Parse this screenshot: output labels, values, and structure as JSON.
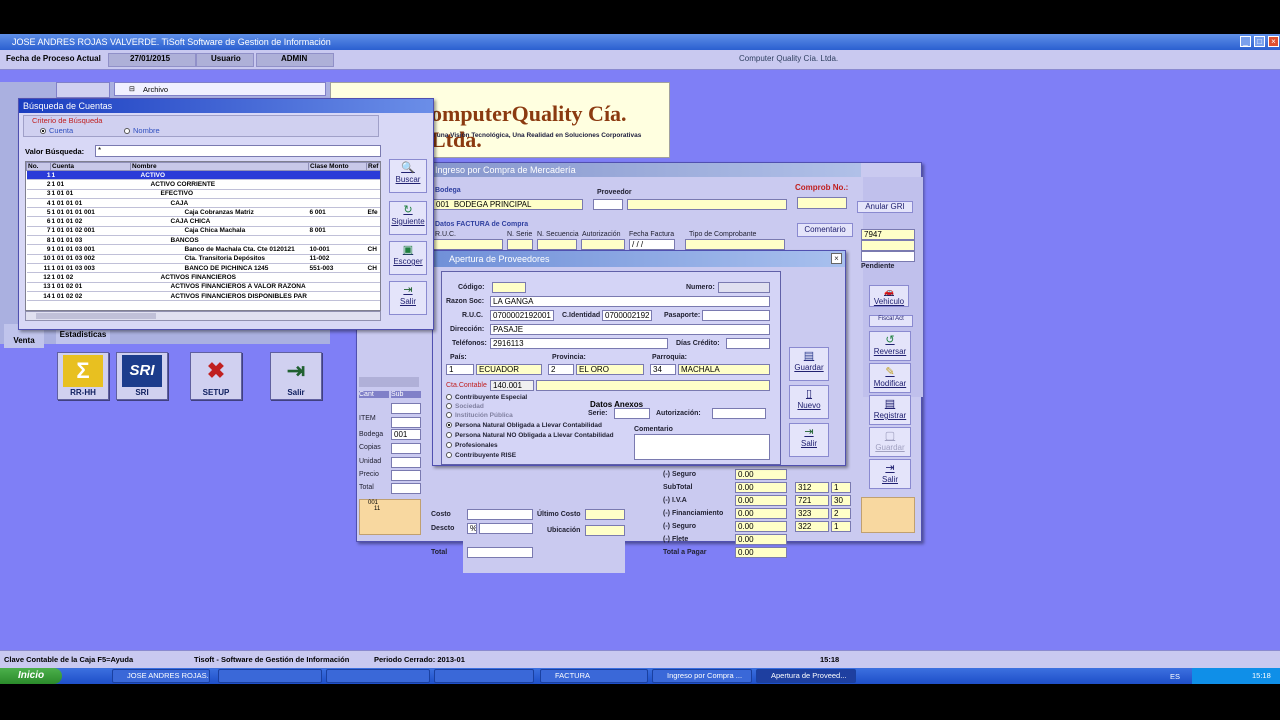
{
  "app": {
    "title": "JOSE ANDRES ROJAS VALVERDE. TiSoft Software de Gestion de Información",
    "company": "Computer Quality Cía. Ltda."
  },
  "infobar": {
    "fecha_label": "Fecha de Proceso Actual",
    "fecha_value": "27/01/2015",
    "usuario_label": "Usuario",
    "usuario_value": "ADMIN"
  },
  "menu": {
    "archivo": "Archivo"
  },
  "banner": {
    "name": "omputerQuality Cía. Ltda.",
    "slogan": "u una Visión Tecnológica, Una Realidad en Soluciones Corporativas"
  },
  "leftnav": {
    "ventas": "Venta",
    "estadisticas": "Estadisticas",
    "a": "A",
    "b": "B",
    "inv": "Inve"
  },
  "bigicons": [
    {
      "label": "RR-HH",
      "icon": "sigma-icon"
    },
    {
      "label": "SRI",
      "icon": "sri-logo"
    },
    {
      "label": "SETUP",
      "icon": "tools-icon"
    },
    {
      "label": "Salir",
      "icon": "exit-icon"
    }
  ],
  "busqueda": {
    "title": "Búsqueda de Cuentas",
    "criterio": "Criterio de Búsqueda",
    "opt_cuenta": "Cuenta",
    "opt_nombre": "Nombre",
    "valor_label": "Valor Búsqueda:",
    "valor_value": "*",
    "headers": [
      "No.",
      "Cuenta",
      "Nombre",
      "Clase Monto",
      "Ref"
    ],
    "rows": [
      [
        "1",
        "1",
        "ACTIVO",
        "",
        ""
      ],
      [
        "2",
        "1 01",
        "ACTIVO CORRIENTE",
        "",
        ""
      ],
      [
        "3",
        "1 01 01",
        "EFECTIVO",
        "",
        ""
      ],
      [
        "4",
        "1 01 01 01",
        "CAJA",
        "",
        ""
      ],
      [
        "5",
        "1 01 01 01   001",
        "Caja Cobranzas Matriz",
        "6 001",
        "Efe"
      ],
      [
        "6",
        "1 01 01 02",
        "CAJA CHICA",
        "",
        ""
      ],
      [
        "7",
        "1 01 01 02   001",
        "Caja Chica Machala",
        "8 001",
        "",
        ""
      ],
      [
        "8",
        "1 01 01 03",
        "BANCOS",
        "",
        ""
      ],
      [
        "9",
        "1 01 01 03   001",
        "Banco de Machala Cta. Cte 0120121",
        "10-001",
        "CH"
      ],
      [
        "10",
        "1 01 01 03   002",
        "Cta. Transitoria Depósitos",
        "11-002",
        ""
      ],
      [
        "11",
        "1 01 01 03   003",
        "BANCO DE PICHINCA 1245",
        "551-003",
        "CH"
      ],
      [
        "12",
        "1 01 02",
        "ACTIVOS FINANCIEROS",
        "",
        ""
      ],
      [
        "13",
        "1 01 02 01",
        "ACTIVOS FINANCIEROS A VALOR RAZONA",
        "",
        ""
      ],
      [
        "14",
        "1 01 02 02",
        "ACTIVOS FINANCIEROS DISPONIBLES PAR",
        "",
        ""
      ]
    ],
    "buttons": {
      "buscar": "Buscar",
      "siguiente": "Siguiente",
      "escoger": "Escoger",
      "salir": "Salir"
    }
  },
  "compra": {
    "title": "Ingreso por Compra de Mercadería",
    "bodega_label": "Bodega",
    "bodega_code": "001",
    "bodega_value": "BODEGA PRINCIPAL",
    "proveedor_label": "Proveedor",
    "comprob_label": "Comprob No.:",
    "factura_label": "Datos FACTURA de Compra",
    "ruc": "R.U.C.",
    "serie": "N. Serie",
    "secuencia": "N. Secuencia",
    "autorizacion": "Autorización",
    "fecha_fact": "Fecha Factura",
    "tipo_comp": "Tipo de Comprobante",
    "fecha_val": "/ / /",
    "comentario": "Comentario",
    "vehiculo": "Vehiculo",
    "emitir": "Anular GRI",
    "num": "7947",
    "fiscal": "Fiscal Act",
    "pendiente": "Pendiente",
    "reversar": "Reversar",
    "modificar": "Modificar",
    "registrar": "Registrar",
    "guardar": "Guardar",
    "salir": "Salir",
    "cant": "Cant",
    "sub": "Sub",
    "item": "ITEM",
    "bodega2": "Bodega",
    "bodega2_val": "001",
    "copias": "Copias",
    "unidad": "Unidad",
    "precio": "Precio",
    "total": "Total",
    "item_vals": [
      "001",
      "11"
    ],
    "costo": "Costo",
    "ultimo": "Último Costo",
    "descto": "Descto",
    "pct": "%",
    "ubicacion": "Ubicación",
    "total2": "Total",
    "totals": [
      {
        "label": "(-) Seguro",
        "v": "0.00",
        "c1": "",
        "c2": ""
      },
      {
        "label": "SubTotal",
        "v": "0.00",
        "c1": "312",
        "c2": "1"
      },
      {
        "label": "(-) I.V.A",
        "v": "0.00",
        "c1": "721",
        "c2": "30"
      },
      {
        "label": "(-) Financiamiento",
        "v": "0.00",
        "c1": "323",
        "c2": "2"
      },
      {
        "label": "(-) Seguro",
        "v": "0.00",
        "c1": "322",
        "c2": "1"
      },
      {
        "label": "(-) Flete",
        "v": "0.00",
        "c1": "",
        "": ""
      },
      {
        "label": "Total a Pagar",
        "v": "0.00",
        "c1": "",
        "c2": ""
      }
    ]
  },
  "proveedores": {
    "title": "Apertura de Proveedores",
    "codigo": "Código:",
    "numero": "Numero:",
    "razon": "Razon Soc:",
    "razon_val": "LA GANGA",
    "ruc": "R.U.C.",
    "ruc_val": "0700002192001",
    "cid": "C.Identidad",
    "cid_val": "0700002192",
    "pasaporte": "Pasaporte:",
    "direccion": "Dirección:",
    "direccion_val": "PASAJE",
    "telefonos": "Teléfonos:",
    "telefonos_val": "2916113",
    "dias": "Días Crédito:",
    "pais": "País:",
    "pais_code": "1",
    "pais_val": "ECUADOR",
    "provincia": "Provincia:",
    "provincia_code": "2",
    "provincia_val": "EL ORO",
    "parroquia": "Parroquia:",
    "parroquia_code": "34",
    "parroquia_val": "MACHALA",
    "cta": "Cta.Contable",
    "cta_val": "140.001",
    "anexos": "Datos Anexos",
    "serie": "Serie:",
    "autorizacion": "Autorización:",
    "comentario": "Comentario",
    "tipos": [
      "Contribuyente Especial",
      "Sociedad",
      "Institución Pública",
      "Persona Natural Obligada a Llevar Contabilidad",
      "Persona Natural NO Obligada a Llevar Contabilidad",
      "Profesionales",
      "Contribuyente RISE"
    ],
    "guardar": "Guardar",
    "nuevo": "Nuevo",
    "salir": "Salir"
  },
  "status": {
    "s1": "Clave Contable de la Caja  F5=Ayuda",
    "s2": "Tisoft - Software de Gestión de Información",
    "s3": "Periodo Cerrado: 2013-01",
    "time": "15:18"
  },
  "taskbar": {
    "start": "Inicio",
    "tasks": [
      "JOSE ANDRES ROJAS...",
      "",
      "",
      "",
      "FACTURA",
      "Ingreso por Compra ...",
      "Apertura de Proveed..."
    ],
    "lang": "ES",
    "clock": "15:18"
  }
}
